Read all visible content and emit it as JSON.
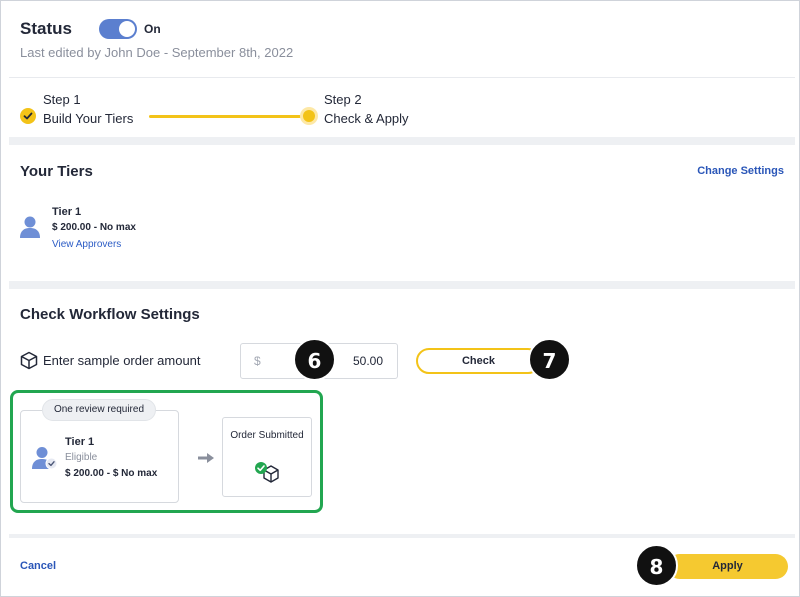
{
  "status": {
    "title": "Status",
    "toggle_label": "On",
    "toggle_on": true,
    "last_edited": "Last edited by John Doe - September 8th, 2022"
  },
  "stepper": {
    "steps": [
      {
        "number": "Step 1",
        "name": "Build Your Tiers",
        "state": "done"
      },
      {
        "number": "Step 2",
        "name": "Check & Apply",
        "state": "current"
      }
    ]
  },
  "tiers": {
    "title": "Your Tiers",
    "change_settings": "Change Settings",
    "items": [
      {
        "name": "Tier 1",
        "range": "$ 200.00 - No max",
        "link": "View Approvers"
      }
    ]
  },
  "workflow": {
    "title": "Check Workflow Settings",
    "sample_label": "Enter sample order amount",
    "amount_prefix": "$",
    "amount_value": "50.00",
    "check_label": "Check",
    "result": {
      "review_pill": "One review required",
      "tier_name": "Tier 1",
      "tier_status": "Eligible",
      "tier_range": "$ 200.00 - $ No max",
      "order_title": "Order Submitted"
    }
  },
  "footer": {
    "cancel_label": "Cancel",
    "apply_label": "Apply"
  },
  "callouts": [
    "6",
    "7",
    "8"
  ],
  "colors": {
    "accent_yellow": "#f3c318",
    "link_blue": "#2a56b8",
    "highlight_green": "#22a650",
    "toggle_blue": "#5b7fcf"
  }
}
